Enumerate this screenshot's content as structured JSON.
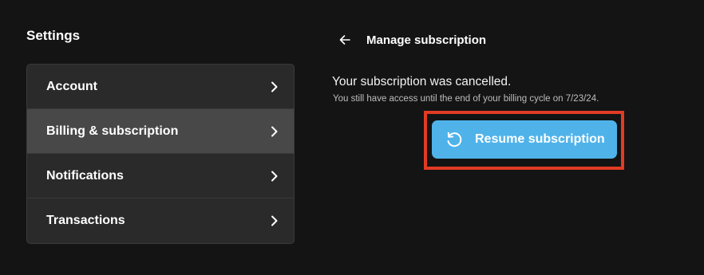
{
  "settings": {
    "title": "Settings",
    "items": [
      {
        "label": "Account",
        "active": false
      },
      {
        "label": "Billing & subscription",
        "active": true
      },
      {
        "label": "Notifications",
        "active": false
      },
      {
        "label": "Transactions",
        "active": false
      }
    ]
  },
  "panel": {
    "title": "Manage subscription",
    "status_message": "Your subscription was cancelled.",
    "access_message": "You still have access until the end of your billing cycle on 7/23/24.",
    "resume_label": "Resume subscription"
  },
  "colors": {
    "background": "#141414",
    "menu_bg": "#2a2a2a",
    "menu_active": "#484848",
    "accent_button": "#4fb3ea",
    "highlight_border": "#e23b24"
  },
  "icons": {
    "back": "arrow-left-icon",
    "chevron": "chevron-right-icon",
    "resume": "refresh-icon"
  }
}
